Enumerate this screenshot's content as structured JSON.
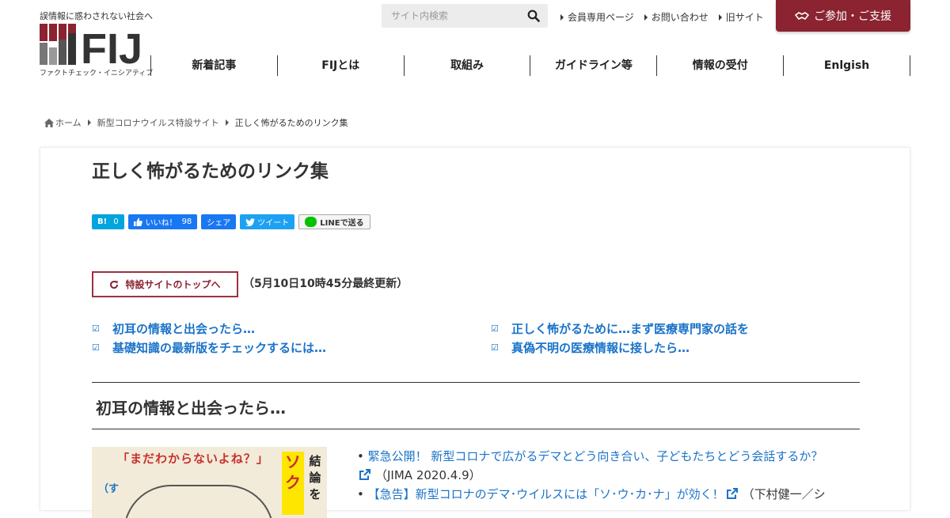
{
  "header": {
    "tagline": "誤情報に惑わされない社会へ",
    "logo_text": "FIJ",
    "logo_subtitle": "ファクトチェック・イニシアティブ",
    "search_placeholder": "サイト内検索",
    "top_links": [
      {
        "label": "会員専用ページ"
      },
      {
        "label": "お問い合わせ"
      },
      {
        "label": "旧サイト"
      }
    ],
    "join_button": "ご参加・ご支援",
    "nav": [
      {
        "label": "新着記事"
      },
      {
        "label": "FIJとは"
      },
      {
        "label": "取組み"
      },
      {
        "label": "ガイドライン等"
      },
      {
        "label": "情報の受付"
      },
      {
        "label": "Enlgish"
      }
    ],
    "brand_color": "#8b2331"
  },
  "breadcrumb": {
    "home": "ホーム",
    "parent": "新型コロナウイルス特設サイト",
    "current": "正しく怖がるためのリンク集"
  },
  "article": {
    "title": "正しく怖がるためのリンク集",
    "share": {
      "hatena_label": "B!",
      "hatena_count": "0",
      "like_label": "いいね！",
      "like_count": "98",
      "share_label": "シェア",
      "tweet_label": "ツイート",
      "line_label": "LINEで送る"
    },
    "top_button": "特設サイトのトップへ",
    "update_note": "（5月10日10時45分最終更新）",
    "toc": [
      {
        "label": "初耳の情報と出会ったら…"
      },
      {
        "label": "正しく怖がるために…まず医療専門家の話を"
      },
      {
        "label": "基礎知識の最新版をチェックするには…"
      },
      {
        "label": "真偽不明の医療情報に接したら…"
      }
    ],
    "toc_check": "☑",
    "section_title": "初耳の情報と出会ったら…",
    "thumbnail": {
      "headline": "「まだわからないよね？」",
      "highlight": "ソク",
      "side_text": "結論を",
      "left_text": "（す"
    },
    "links": {
      "item1_text": "緊急公開！ 新型コロナで広がるデマとどう向き合い、子どもたちとどう会話するか？",
      "item1_source": "（JIMA 2020.4.9）",
      "item2_text": "【急告】新型コロナのデマ･ウイルスには「ソ･ウ･カ･ナ」が効く！",
      "item2_source": "（下村健一／シ"
    }
  }
}
